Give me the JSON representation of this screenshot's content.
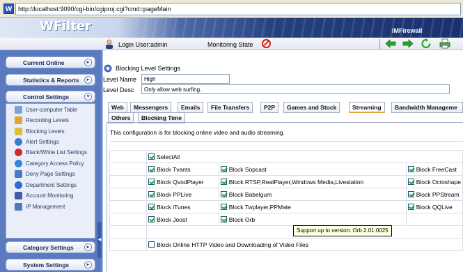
{
  "address_bar": {
    "url": "http://localhost:9090/cgi-bin/cgiproj.cgi?cmd=pageMain",
    "icon": "w-page-icon"
  },
  "header": {
    "logo": "WFilter",
    "product": "IMFirewall"
  },
  "status_bar": {
    "login_label": "Login User:admin",
    "monitoring_label": "Monitoring State",
    "monitoring_icon": "no-entry-icon",
    "toolbar_icons": [
      "back-arrow-icon",
      "forward-arrow-icon",
      "refresh-icon",
      "print-icon"
    ]
  },
  "sidebar": {
    "top_buttons": [
      "Current Online",
      "Statistics & Reports"
    ],
    "control_settings": {
      "label": "Control Settings",
      "items": [
        {
          "label": "User-computer Table",
          "icon": "computer-icon"
        },
        {
          "label": "Recording Levels",
          "icon": "recording-icon"
        },
        {
          "label": "Blocking Levels",
          "icon": "blocking-icon"
        },
        {
          "label": "Alert Settings",
          "icon": "alert-icon"
        },
        {
          "label": "Black/White List Settings",
          "icon": "blacklist-icon"
        },
        {
          "label": "Category Access Policy",
          "icon": "globe-icon"
        },
        {
          "label": "Deny Page Settings",
          "icon": "deny-page-icon"
        },
        {
          "label": "Department Settings",
          "icon": "department-icon"
        },
        {
          "label": "Account Monitoring",
          "icon": "account-icon"
        },
        {
          "label": "IP Management",
          "icon": "wrench-icon"
        }
      ]
    },
    "bottom_buttons": [
      "Category Settings",
      "System Settings"
    ]
  },
  "main": {
    "title": "Blocking Level Settings",
    "level_name_label": "Level Name",
    "level_name_value": "High",
    "level_desc_label": "Level Desc",
    "level_desc_value": "Only allow web surfing.",
    "tabs_row1": [
      "Web",
      "Messengers",
      "Emails",
      "File Transfers",
      "P2P",
      "Games and Stock",
      "Streaming",
      "Bandwidth Manageme"
    ],
    "tabs_row2": [
      "Others",
      "Blocking Time"
    ],
    "active_tab": "Streaming",
    "description": "This configuration is for blocking online video and audio streaming.",
    "select_all": "SelectAll",
    "col1": [
      "Block Tvants",
      "Block QvodPlayer",
      "Block PPLive",
      "Block iTunes",
      "Block Joost"
    ],
    "col2": [
      "Block Sopcast",
      "Block RTSP,RealPlayer,Windows Media,Livestation",
      "Block Babelgum",
      "Block Twplayer,PPMate",
      "Block Orb"
    ],
    "col3": [
      "Block FreeCast",
      "Block Octoshape",
      "Block PPStream",
      "Block QQLive"
    ],
    "http_video": "Block Online HTTP Video and Downloading of Video Files",
    "tooltip": "Support up to version: Orb 2.01.0025"
  },
  "colors": {
    "sidebar_bg": "#5b7bc0",
    "banner_dark": "#1a3070",
    "active_tab_accent": "#e8a33d",
    "check_green": "#21a121"
  }
}
